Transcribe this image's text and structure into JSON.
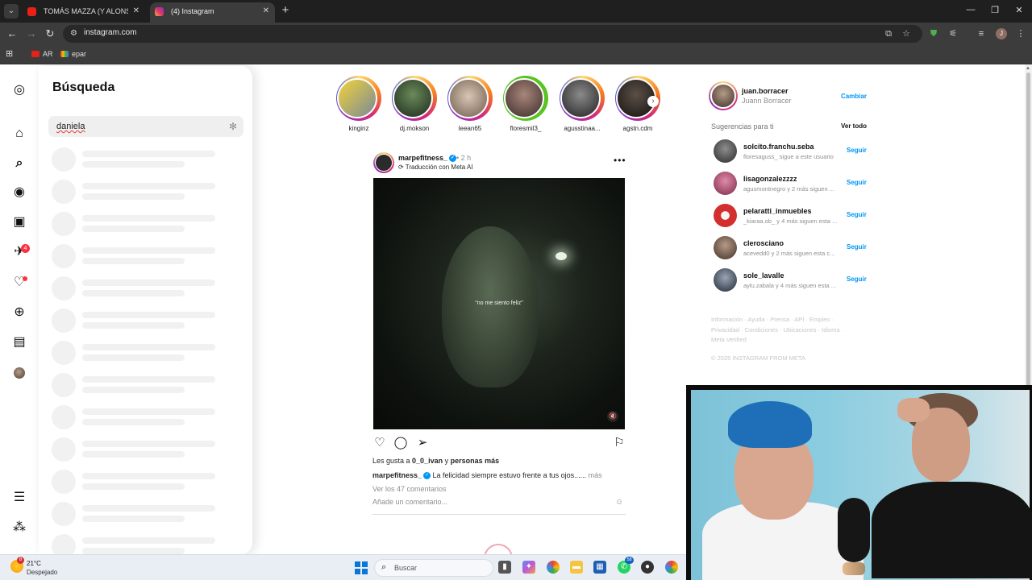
{
  "browser": {
    "tabs": [
      {
        "title": "TOMÁS MAZZA (Y ALONSO) Y",
        "favicon": "youtube-icon",
        "active": false
      },
      {
        "title": "(4) Instagram",
        "favicon": "instagram-icon",
        "active": true
      }
    ],
    "url": "instagram.com",
    "bookmarks": [
      {
        "label": "AR",
        "icon": "youtube-icon"
      },
      {
        "label": "epar",
        "icon": "gmail-icon"
      }
    ],
    "profile_initial": "J"
  },
  "nav": {
    "notification_count": "4"
  },
  "search": {
    "title": "Búsqueda",
    "query": "daniela"
  },
  "stories": [
    {
      "name": "kinginz"
    },
    {
      "name": "dj.mokson"
    },
    {
      "name": "leean65"
    },
    {
      "name": "floresmil3_"
    },
    {
      "name": "agusstinaa..."
    },
    {
      "name": "agstn.cdm"
    }
  ],
  "post": {
    "username": "marpefitness_",
    "time": "2 h",
    "translation": "Traducción con Meta AI",
    "media_caption": "“no me siento feliz”",
    "likes_prefix": "Les gusta a ",
    "likes_user": "0_0_ivan",
    "likes_mid": " y ",
    "likes_more": "personas más",
    "caption_user": "marpefitness_",
    "caption_text": "La felicidad siempre estuvo frente a tus ojos......",
    "caption_more": "más",
    "comments_link": "Ver los 47 comentarios",
    "add_comment": "Añade un comentario..."
  },
  "sidebar": {
    "me_username": "juan.borracer",
    "me_name": "Juann Borracer",
    "switch_label": "Cambiar",
    "suggestions_title": "Sugerencias para ti",
    "see_all": "Ver todo",
    "follow_label": "Seguir",
    "suggestions": [
      {
        "username": "solcito.franchu.seba",
        "sub": "floresaguss_ sigue a este usuario",
        "color": "#3a3a3a"
      },
      {
        "username": "lisagonzalezzzz",
        "sub": "agusmontnegro y 2 más siguen ...",
        "color": "#b0486a"
      },
      {
        "username": "pelaratti_inmuebles",
        "sub": "_kiaraa.ob_ y 4 más siguen esta ...",
        "color": "#d32f2f"
      },
      {
        "username": "clerosciano",
        "sub": "acevedd0 y 2 más siguen esta c...",
        "color": "#6b5a4e"
      },
      {
        "username": "sole_lavalle",
        "sub": "aylu.zabala y 4 más siguen esta ...",
        "color": "#2f3a4a"
      }
    ],
    "footer_links": "Información · Ayuda · Prensa · API · Empleo · Privacidad · Condiciones · Ubicaciones · Idioma · Meta Verified",
    "copyright": "© 2025 INSTAGRAM FROM META"
  },
  "taskbar": {
    "weather_badge": "8",
    "temperature": "21°C",
    "weather_desc": "Despejado",
    "search_placeholder": "Buscar",
    "badges": [
      "58"
    ]
  },
  "colors": {
    "accent_blue": "#0095f6",
    "notification_red": "#ff3040"
  }
}
